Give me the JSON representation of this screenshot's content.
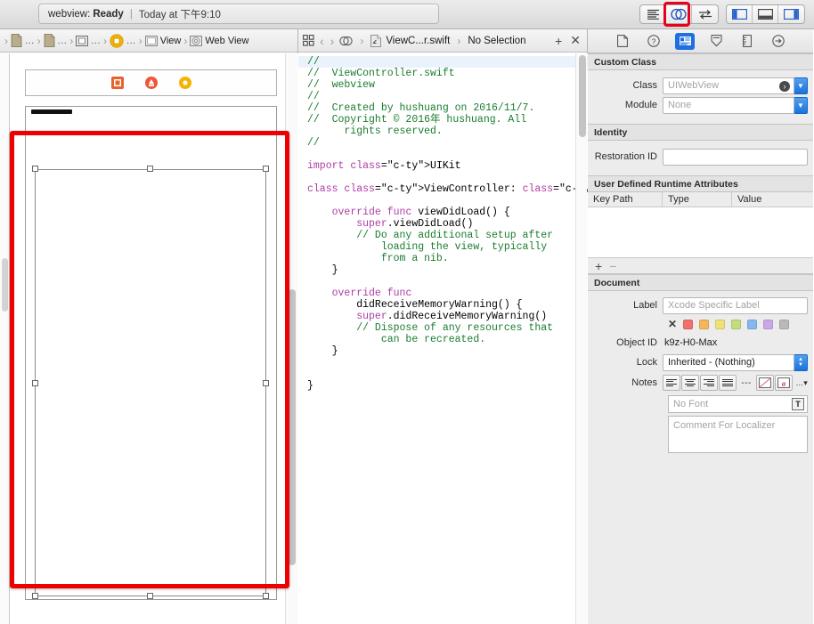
{
  "toolbar": {
    "status": {
      "project": "webview:",
      "state": "Ready",
      "separator": "|",
      "time": "Today at 下午9:10"
    },
    "editor_modes": [
      {
        "name": "standard-editor",
        "icon": "lines-icon",
        "active": false
      },
      {
        "name": "assistant-editor",
        "icon": "venn-circles-icon",
        "active": true
      },
      {
        "name": "version-editor",
        "icon": "swap-arrows-icon",
        "active": false
      }
    ],
    "view_toggles": [
      {
        "name": "navigator-toggle",
        "icon": "left-panel-icon"
      },
      {
        "name": "debug-toggle",
        "icon": "bottom-panel-icon"
      },
      {
        "name": "inspector-toggle",
        "icon": "right-panel-icon"
      }
    ],
    "highlight_color": "#e8001c"
  },
  "ib": {
    "breadcrumb": [
      {
        "icon": "document-icon",
        "label": "..."
      },
      {
        "icon": "document-icon",
        "label": "..."
      },
      {
        "icon": "storyboard-icon",
        "label": "..."
      },
      {
        "icon": "view-controller-icon",
        "label": "..."
      },
      {
        "icon": "view-square-icon",
        "label": "View"
      },
      {
        "icon": "web-view-icon",
        "label": "Web View"
      }
    ],
    "scene_dock": [
      {
        "name": "view-controller-dock-icon",
        "color": "#e8622e"
      },
      {
        "name": "first-responder-dock-icon",
        "color": "#ef553a"
      },
      {
        "name": "exit-dock-icon",
        "color": "#f5b301"
      }
    ],
    "selection": {
      "name": "web-view-selection",
      "color": "#ee0000"
    }
  },
  "code": {
    "jumpbar": {
      "related_items_icon": "grid-icon",
      "back_arrow": "‹",
      "forward_arrow": "›",
      "assistant_icon": "venn-circles-icon",
      "file": "ViewC...r.swift",
      "selection": "No Selection",
      "add": "+",
      "close": "✕"
    },
    "lines": [
      {
        "type": "comment",
        "text": "//",
        "current": true
      },
      {
        "type": "comment",
        "text": "//  ViewController.swift"
      },
      {
        "type": "comment",
        "text": "//  webview"
      },
      {
        "type": "comment",
        "text": "//"
      },
      {
        "type": "comment",
        "text": "//  Created by hushuang on 2016/11/7."
      },
      {
        "type": "comment",
        "text": "//  Copyright © 2016年 hushuang. All"
      },
      {
        "type": "comment",
        "text": "      rights reserved."
      },
      {
        "type": "comment",
        "text": "//"
      },
      {
        "type": "blank",
        "text": ""
      },
      {
        "type": "code",
        "text": "import UIKit"
      },
      {
        "type": "blank",
        "text": ""
      },
      {
        "type": "code",
        "text": "class ViewController: UIViewController {"
      },
      {
        "type": "blank",
        "text": ""
      },
      {
        "type": "code",
        "text": "    override func viewDidLoad() {"
      },
      {
        "type": "code",
        "text": "        super.viewDidLoad()"
      },
      {
        "type": "comment",
        "text": "        // Do any additional setup after"
      },
      {
        "type": "comment",
        "text": "            loading the view, typically"
      },
      {
        "type": "comment",
        "text": "            from a nib."
      },
      {
        "type": "code",
        "text": "    }"
      },
      {
        "type": "blank",
        "text": ""
      },
      {
        "type": "code",
        "text": "    override func"
      },
      {
        "type": "code",
        "text": "        didReceiveMemoryWarning() {"
      },
      {
        "type": "code",
        "text": "        super.didReceiveMemoryWarning()"
      },
      {
        "type": "comment",
        "text": "        // Dispose of any resources that"
      },
      {
        "type": "comment",
        "text": "            can be recreated."
      },
      {
        "type": "code",
        "text": "    }"
      },
      {
        "type": "blank",
        "text": ""
      },
      {
        "type": "blank",
        "text": ""
      },
      {
        "type": "code",
        "text": "}"
      }
    ]
  },
  "inspector": {
    "tabs": [
      {
        "name": "file-inspector-tab",
        "icon": "document-icon",
        "active": false
      },
      {
        "name": "quick-help-tab",
        "icon": "question-circle-icon",
        "active": false
      },
      {
        "name": "identity-inspector-tab",
        "icon": "id-card-icon",
        "active": true
      },
      {
        "name": "attributes-inspector-tab",
        "icon": "slider-down-icon",
        "active": false
      },
      {
        "name": "size-inspector-tab",
        "icon": "ruler-icon",
        "active": false
      },
      {
        "name": "connections-inspector-tab",
        "icon": "arrow-circle-icon",
        "active": false
      }
    ],
    "custom_class": {
      "header": "Custom Class",
      "class_label": "Class",
      "class_value": "UIWebView",
      "module_label": "Module",
      "module_value": "None"
    },
    "identity": {
      "header": "Identity",
      "restoration_label": "Restoration ID",
      "restoration_value": ""
    },
    "runtime_attributes": {
      "header": "User Defined Runtime Attributes",
      "columns": [
        "Key Path",
        "Type",
        "Value"
      ],
      "rows": [],
      "add": "+",
      "remove": "−"
    },
    "document": {
      "header": "Document",
      "label_label": "Label",
      "label_placeholder": "Xcode Specific Label",
      "colors": [
        "#3d3d3d",
        "#f0716d",
        "#f5b55c",
        "#efe178",
        "#c2dd7e",
        "#86b8ef",
        "#cba7e8",
        "#b9b9b9"
      ],
      "object_id_label": "Object ID",
      "object_id_value": "k9z-H0-Max",
      "lock_label": "Lock",
      "lock_value": "Inherited - (Nothing)",
      "notes_label": "Notes",
      "notes_buttons": [
        "align-left-icon",
        "align-center-icon",
        "align-right-icon",
        "align-justify-icon",
        "dashes-icon",
        "no-color-icon",
        "text-color-icon",
        "more-icon"
      ],
      "font_placeholder": "No Font",
      "font_picker_icon": "font-panel-icon",
      "comment_placeholder": "Comment For Localizer"
    }
  }
}
